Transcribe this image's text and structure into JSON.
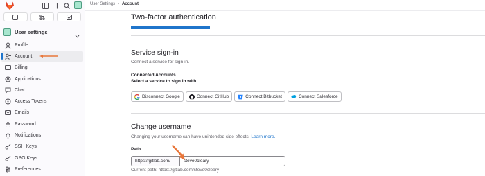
{
  "colors": {
    "accent": "#1f75cb",
    "annotation": "#e8763a",
    "logo": "#e24329"
  },
  "topbar": {
    "icons": [
      "gitlab-logo-icon",
      "sidebar-toggle-icon",
      "plus-icon",
      "search-icon"
    ],
    "tab_icons": [
      "issues-icon",
      "merge-request-icon",
      "todo-icon"
    ]
  },
  "sidebar": {
    "context_title": "User settings",
    "items": [
      {
        "label": "Profile",
        "icon": "profile-icon"
      },
      {
        "label": "Account",
        "icon": "account-icon",
        "active": true
      },
      {
        "label": "Billing",
        "icon": "billing-icon"
      },
      {
        "label": "Applications",
        "icon": "applications-icon"
      },
      {
        "label": "Chat",
        "icon": "chat-icon"
      },
      {
        "label": "Access Tokens",
        "icon": "token-icon"
      },
      {
        "label": "Emails",
        "icon": "email-icon"
      },
      {
        "label": "Password",
        "icon": "lock-icon"
      },
      {
        "label": "Notifications",
        "icon": "bell-icon"
      },
      {
        "label": "SSH Keys",
        "icon": "key-icon"
      },
      {
        "label": "GPG Keys",
        "icon": "key-icon"
      },
      {
        "label": "Preferences",
        "icon": "preferences-icon"
      }
    ]
  },
  "breadcrumb": {
    "parent": "User Settings",
    "separator": "›",
    "current": "Account"
  },
  "main": {
    "two_factor_title": "Two-factor authentication",
    "service": {
      "title": "Service sign-in",
      "subtitle": "Connect a service for sign-in.",
      "connected_title": "Connected Accounts",
      "connected_subtitle": "Select a service to sign in with.",
      "buttons": [
        {
          "label": "Disconnect Google",
          "icon": "google-icon"
        },
        {
          "label": "Connect GitHub",
          "icon": "github-icon"
        },
        {
          "label": "Connect Bitbucket",
          "icon": "bitbucket-icon"
        },
        {
          "label": "Connect Salesforce",
          "icon": "salesforce-icon"
        }
      ]
    },
    "username": {
      "title": "Change username",
      "subtitle": "Changing your username can have unintended side effects.",
      "learn_more": "Learn more.",
      "path_label": "Path",
      "path_prefix": "https://gitlab.com/",
      "path_value": "steve0cleary",
      "current_path": "Current path: https://gitlab.com/steve0cleary"
    }
  }
}
